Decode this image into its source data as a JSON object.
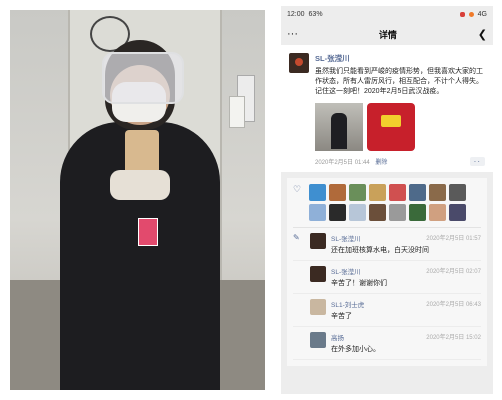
{
  "status": {
    "time": "12:00",
    "battery": "63%",
    "signal": "4G"
  },
  "nav": {
    "title": "详情",
    "back_icon": "back-arrow-icon",
    "more_icon": "more-dots-icon"
  },
  "post": {
    "author": "SL-张滢川",
    "text": "虽然我们只能看到严峻的疫情形势，但我喜欢大家的工作状态，所有人雷厉风行，相互配合，不计个人得失。记住这一刻吧！2020年2月5日武汉战疫。",
    "time": "2020年2月5日 01:44",
    "delete_label": "删除",
    "more_label": "··"
  },
  "likes": {
    "count_label": "",
    "avatar_colors": [
      "#3f8fd0",
      "#b06a3a",
      "#6a8f5a",
      "#c9a15a",
      "#d05050",
      "#4e6a8a",
      "#8a6a4a",
      "#5a5a5a",
      "#8fb0d8",
      "#2a2a2a",
      "#b7c6d8",
      "#6b4f3a",
      "#9a9a9a",
      "#3a6a3a",
      "#d0a080",
      "#4a4a6a"
    ]
  },
  "comments": [
    {
      "name": "SL-张滢川",
      "time": "2020年2月5日 01:57",
      "text": "还在加班核算水电，白天没时间",
      "avatar_color": "#3b2a22"
    },
    {
      "name": "SL-张滢川",
      "time": "2020年2月5日 02:07",
      "text": "辛苦了！谢谢你们",
      "avatar_color": "#3b2a22"
    },
    {
      "name": "SL1-刘士虎",
      "time": "2020年2月5日 06:43",
      "text": "辛苦了",
      "avatar_color": "#c9b7a0"
    },
    {
      "name": "高扬",
      "time": "2020年2月5日 15:02",
      "text": "在外多加小心。",
      "avatar_color": "#6a7a8a"
    }
  ],
  "colors": {
    "link": "#576b95",
    "bg": "#ededed"
  }
}
